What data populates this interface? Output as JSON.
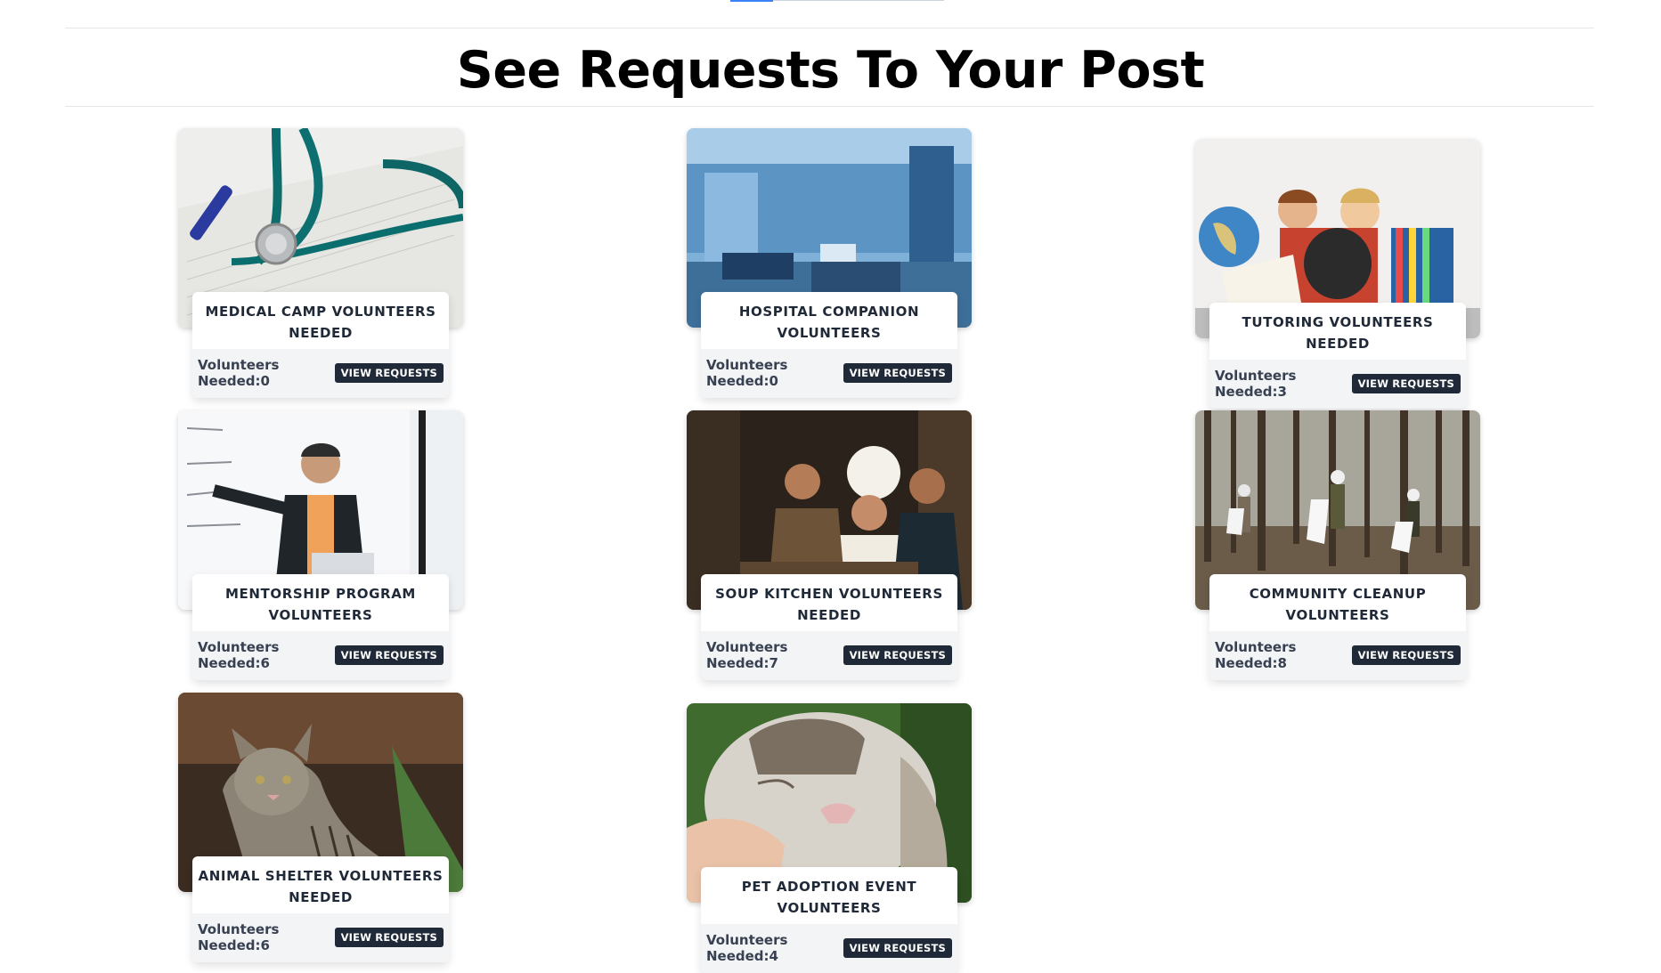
{
  "page": {
    "title": "See Requests To Your Post"
  },
  "cards": [
    {
      "title": "MEDICAL CAMP VOLUNTEERS NEEDED",
      "needed_label": "Volunteers Needed:",
      "needed_count": "0",
      "button_label": "VIEW REQUESTS",
      "image": "stethoscope-on-papers"
    },
    {
      "title": "HOSPITAL COMPANION VOLUNTEERS",
      "needed_label": "Volunteers Needed:",
      "needed_count": "0",
      "button_label": "VIEW REQUESTS",
      "image": "hospital-ward"
    },
    {
      "title": "TUTORING VOLUNTEERS NEEDED",
      "needed_label": "Volunteers Needed:",
      "needed_count": "3",
      "button_label": "VIEW REQUESTS",
      "image": "kids-with-globe-and-books"
    },
    {
      "title": "MENTORSHIP PROGRAM VOLUNTEERS",
      "needed_label": "Volunteers Needed:",
      "needed_count": "6",
      "button_label": "VIEW REQUESTS",
      "image": "teacher-at-whiteboard"
    },
    {
      "title": "SOUP KITCHEN VOLUNTEERS NEEDED",
      "needed_label": "Volunteers Needed:",
      "needed_count": "7",
      "button_label": "VIEW REQUESTS",
      "image": "chefs-in-kitchen"
    },
    {
      "title": "COMMUNITY CLEANUP VOLUNTEERS",
      "needed_label": "Volunteers Needed:",
      "needed_count": "8",
      "button_label": "VIEW REQUESTS",
      "image": "forest-cleanup"
    },
    {
      "title": "ANIMAL SHELTER VOLUNTEERS NEEDED",
      "needed_label": "Volunteers Needed:",
      "needed_count": "6",
      "button_label": "VIEW REQUESTS",
      "image": "tabby-cat"
    },
    {
      "title": "PET ADOPTION EVENT VOLUNTEERS",
      "needed_label": "Volunteers Needed:",
      "needed_count": "4",
      "button_label": "VIEW REQUESTS",
      "image": "cat-being-petted"
    }
  ]
}
